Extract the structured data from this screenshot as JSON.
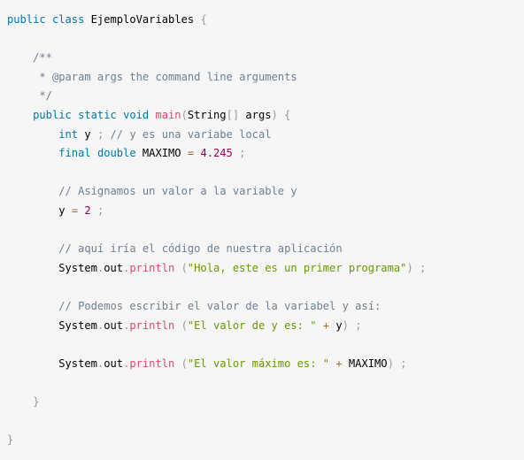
{
  "code_block": {
    "lines": [
      [
        {
          "text": "public",
          "type": "keyword"
        },
        {
          "text": " ",
          "type": "plain"
        },
        {
          "text": "class",
          "type": "keyword"
        },
        {
          "text": " EjemploVariables ",
          "type": "class-name"
        },
        {
          "text": "{",
          "type": "punctuation"
        }
      ],
      [],
      [
        {
          "text": "    /**",
          "type": "comment"
        }
      ],
      [
        {
          "text": "     * @param args the command line arguments",
          "type": "comment"
        }
      ],
      [
        {
          "text": "     */",
          "type": "comment"
        }
      ],
      [
        {
          "text": "    ",
          "type": "plain"
        },
        {
          "text": "public",
          "type": "keyword"
        },
        {
          "text": " ",
          "type": "plain"
        },
        {
          "text": "static",
          "type": "keyword"
        },
        {
          "text": " ",
          "type": "plain"
        },
        {
          "text": "void",
          "type": "keyword"
        },
        {
          "text": " ",
          "type": "plain"
        },
        {
          "text": "main",
          "type": "function"
        },
        {
          "text": "(",
          "type": "punctuation"
        },
        {
          "text": "String",
          "type": "class-name"
        },
        {
          "text": "[",
          "type": "punctuation"
        },
        {
          "text": "]",
          "type": "punctuation"
        },
        {
          "text": " args",
          "type": "plain"
        },
        {
          "text": ")",
          "type": "punctuation"
        },
        {
          "text": " ",
          "type": "plain"
        },
        {
          "text": "{",
          "type": "punctuation"
        }
      ],
      [
        {
          "text": "        ",
          "type": "plain"
        },
        {
          "text": "int",
          "type": "keyword"
        },
        {
          "text": " y ",
          "type": "plain"
        },
        {
          "text": ";",
          "type": "punctuation"
        },
        {
          "text": " // y es una variabe local",
          "type": "comment"
        }
      ],
      [
        {
          "text": "        ",
          "type": "plain"
        },
        {
          "text": "final",
          "type": "keyword"
        },
        {
          "text": " ",
          "type": "plain"
        },
        {
          "text": "double",
          "type": "keyword"
        },
        {
          "text": " MAXIMO ",
          "type": "plain"
        },
        {
          "text": "=",
          "type": "operator"
        },
        {
          "text": " ",
          "type": "plain"
        },
        {
          "text": "4.245",
          "type": "number"
        },
        {
          "text": " ",
          "type": "plain"
        },
        {
          "text": ";",
          "type": "punctuation"
        }
      ],
      [],
      [
        {
          "text": "        // Asignamos un valor a la variable y",
          "type": "comment"
        }
      ],
      [
        {
          "text": "        y ",
          "type": "plain"
        },
        {
          "text": "=",
          "type": "operator"
        },
        {
          "text": " ",
          "type": "plain"
        },
        {
          "text": "2",
          "type": "number"
        },
        {
          "text": " ",
          "type": "plain"
        },
        {
          "text": ";",
          "type": "punctuation"
        }
      ],
      [],
      [
        {
          "text": "        // aquí iría el código de nuestra aplicación",
          "type": "comment"
        }
      ],
      [
        {
          "text": "        System",
          "type": "class-name"
        },
        {
          "text": ".",
          "type": "punctuation"
        },
        {
          "text": "out",
          "type": "plain"
        },
        {
          "text": ".",
          "type": "punctuation"
        },
        {
          "text": "println",
          "type": "function"
        },
        {
          "text": " ",
          "type": "plain"
        },
        {
          "text": "(",
          "type": "punctuation"
        },
        {
          "text": "\"Hola, este es un primer programa\"",
          "type": "string"
        },
        {
          "text": ")",
          "type": "punctuation"
        },
        {
          "text": " ",
          "type": "plain"
        },
        {
          "text": ";",
          "type": "punctuation"
        }
      ],
      [],
      [
        {
          "text": "        // Podemos escribir el valor de la variabel y así:",
          "type": "comment"
        }
      ],
      [
        {
          "text": "        System",
          "type": "class-name"
        },
        {
          "text": ".",
          "type": "punctuation"
        },
        {
          "text": "out",
          "type": "plain"
        },
        {
          "text": ".",
          "type": "punctuation"
        },
        {
          "text": "println",
          "type": "function"
        },
        {
          "text": " ",
          "type": "plain"
        },
        {
          "text": "(",
          "type": "punctuation"
        },
        {
          "text": "\"El valor de y es: \"",
          "type": "string"
        },
        {
          "text": " ",
          "type": "plain"
        },
        {
          "text": "+",
          "type": "operator"
        },
        {
          "text": " y",
          "type": "plain"
        },
        {
          "text": ")",
          "type": "punctuation"
        },
        {
          "text": " ",
          "type": "plain"
        },
        {
          "text": ";",
          "type": "punctuation"
        }
      ],
      [],
      [
        {
          "text": "        System",
          "type": "class-name"
        },
        {
          "text": ".",
          "type": "punctuation"
        },
        {
          "text": "out",
          "type": "plain"
        },
        {
          "text": ".",
          "type": "punctuation"
        },
        {
          "text": "println",
          "type": "function"
        },
        {
          "text": " ",
          "type": "plain"
        },
        {
          "text": "(",
          "type": "punctuation"
        },
        {
          "text": "\"El valor máximo es: \"",
          "type": "string"
        },
        {
          "text": " ",
          "type": "plain"
        },
        {
          "text": "+",
          "type": "operator"
        },
        {
          "text": " MAXIMO",
          "type": "plain"
        },
        {
          "text": ")",
          "type": "punctuation"
        },
        {
          "text": " ",
          "type": "plain"
        },
        {
          "text": ";",
          "type": "punctuation"
        }
      ],
      [],
      [
        {
          "text": "    ",
          "type": "plain"
        },
        {
          "text": "}",
          "type": "punctuation"
        }
      ],
      [],
      [
        {
          "text": "}",
          "type": "punctuation"
        }
      ]
    ]
  }
}
